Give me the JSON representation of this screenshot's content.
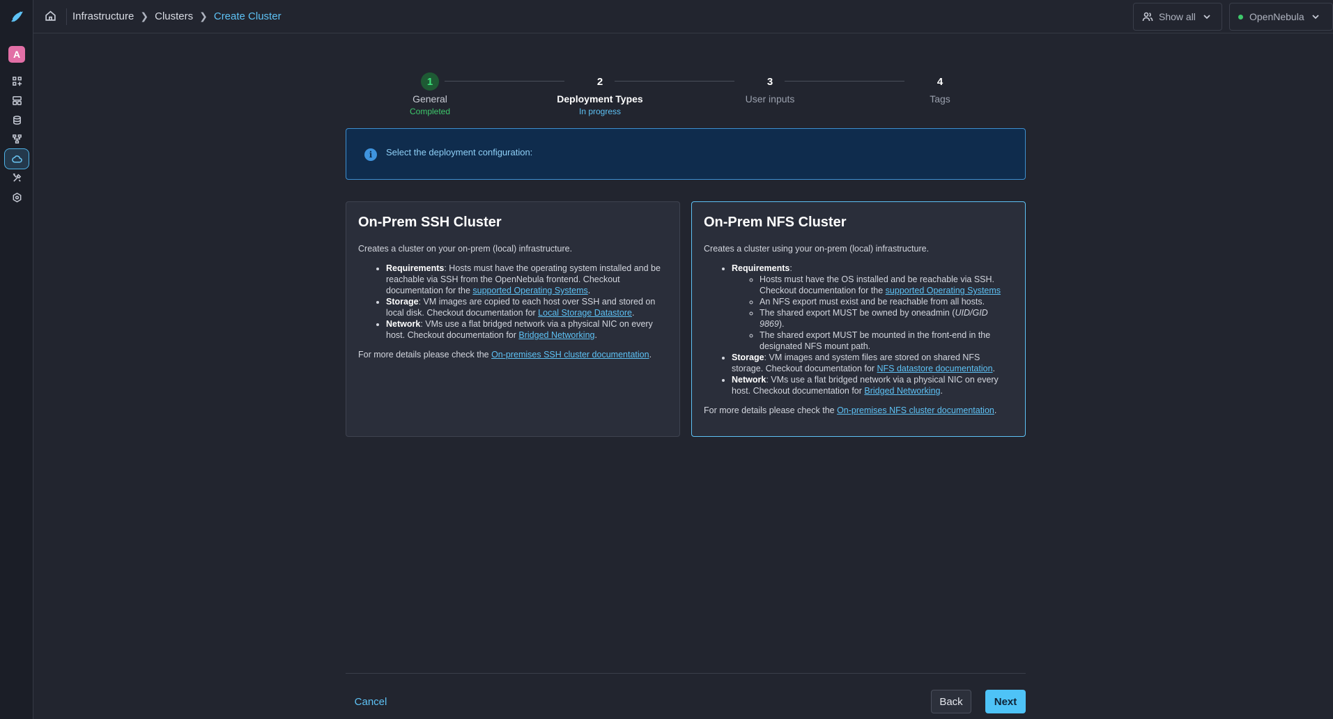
{
  "app": {
    "avatar_letter": "A"
  },
  "sidebar": {
    "icons": [
      "dashboard-icon",
      "templates-icon",
      "storage-icon",
      "network-icon",
      "cloud-icon",
      "tools-icon",
      "settings-icon"
    ]
  },
  "breadcrumb": {
    "items": [
      "Infrastructure",
      "Clusters",
      "Create Cluster"
    ]
  },
  "topbar": {
    "show_all_label": "Show all",
    "zone_label": "OpenNebula",
    "zone_status_color": "#3ec86b"
  },
  "stepper": {
    "steps": [
      {
        "number": "1",
        "label": "General",
        "status": "Completed"
      },
      {
        "number": "2",
        "label": "Deployment Types",
        "status": "In progress"
      },
      {
        "number": "3",
        "label": "User inputs",
        "status": ""
      },
      {
        "number": "4",
        "label": "Tags",
        "status": ""
      }
    ]
  },
  "info": {
    "text": "Select the deployment configuration:"
  },
  "cards": {
    "ssh": {
      "title": "On-Prem SSH Cluster",
      "desc": "Creates a cluster on your on-prem (local) infrastructure.",
      "req_label": "Requirements",
      "req_text": ": Hosts must have the operating system installed and be reachable via SSH from the OpenNebula frontend. Checkout documentation for the ",
      "req_link": "supported Operating Systems",
      "storage_label": "Storage",
      "storage_text": ": VM images are copied to each host over SSH and stored on local disk. Checkout documentation for ",
      "storage_link": "Local Storage Datastore",
      "network_label": "Network",
      "network_text": ": VMs use a flat bridged network via a physical NIC on every host. Checkout documentation for ",
      "network_link": "Bridged Networking",
      "footer_text": "For more details please check the ",
      "footer_link": "On-premises SSH cluster documentation"
    },
    "nfs": {
      "title": "On-Prem NFS Cluster",
      "desc": "Creates a cluster using your on-prem (local) infrastructure.",
      "req_label": "Requirements",
      "req_1_text": "Hosts must have the OS installed and be reachable via SSH. Checkout documentation for the ",
      "req_1_link": "supported Operating Systems",
      "req_2_text": "An NFS export must exist and be reachable from all hosts.",
      "req_3_text": "The shared export MUST be owned by oneadmin (",
      "req_3_italic": "UID/GID 9869",
      "req_3_end": ").",
      "req_4_text": "The shared export MUST be mounted in the front-end in the designated NFS mount path.",
      "storage_label": "Storage",
      "storage_text": ": VM images and system files are stored on shared NFS storage. Checkout documentation for ",
      "storage_link": "NFS datastore documentation",
      "network_label": "Network",
      "network_text": ": VMs use a flat bridged network via a physical NIC on every host. Checkout documentation for ",
      "network_link": "Bridged Networking",
      "footer_text": "For more details please check the ",
      "footer_link": "On-premises NFS cluster documentation"
    }
  },
  "footer": {
    "cancel_label": "Cancel",
    "back_label": "Back",
    "next_label": "Next"
  }
}
